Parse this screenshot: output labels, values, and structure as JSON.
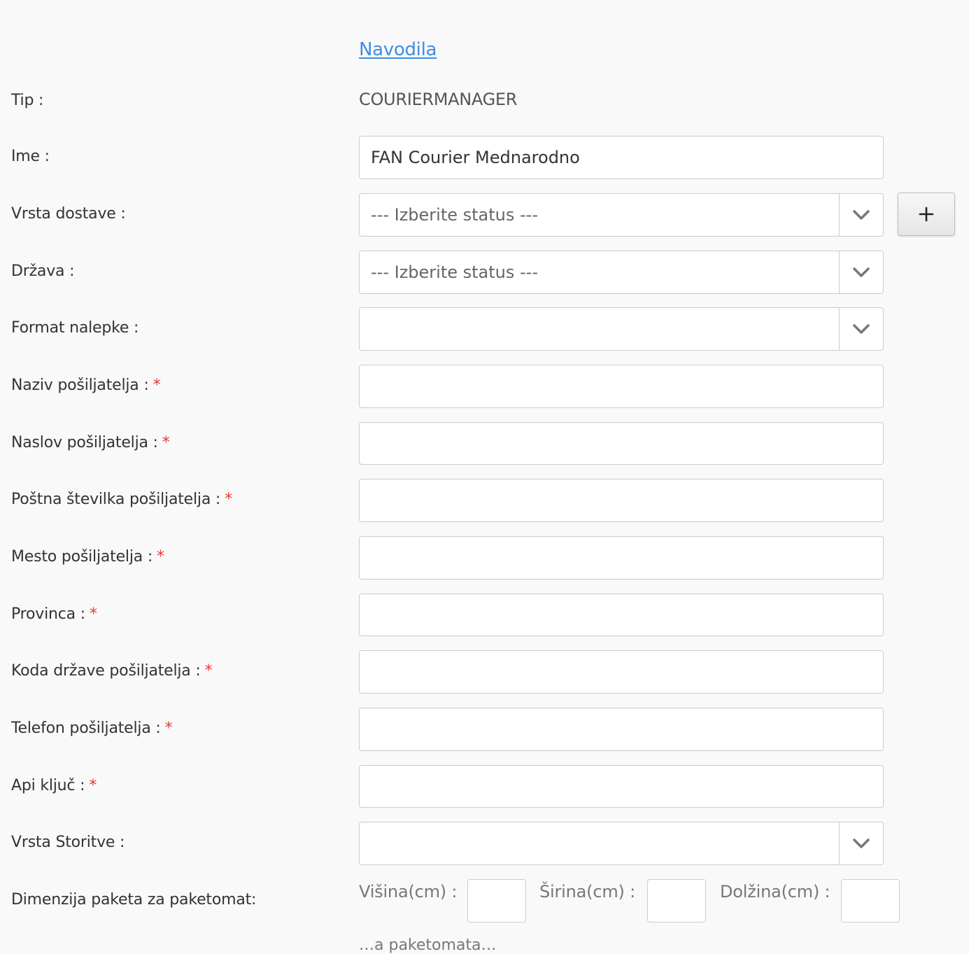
{
  "header": {
    "instructions_link": "Navodila"
  },
  "fields": {
    "tip": {
      "label": "Tip :",
      "value": "COURIERMANAGER"
    },
    "ime": {
      "label": "Ime :",
      "value": "FAN Courier Mednarodno"
    },
    "vrsta_dostave": {
      "label": "Vrsta dostave :",
      "value": "--- Izberite status ---"
    },
    "drzava": {
      "label": "Država :",
      "value": "--- Izberite status ---"
    },
    "format_nalepke": {
      "label": "Format nalepke :",
      "value": ""
    },
    "naziv_posiljatelja": {
      "label": "Naziv pošiljatelja :",
      "value": ""
    },
    "naslov_posiljatelja": {
      "label": "Naslov pošiljatelja :",
      "value": ""
    },
    "postna_stevilka": {
      "label": "Poštna številka pošiljatelja :",
      "value": ""
    },
    "mesto_posiljatelja": {
      "label": "Mesto pošiljatelja :",
      "value": ""
    },
    "provinca": {
      "label": "Provinca :",
      "value": ""
    },
    "koda_drzave": {
      "label": "Koda države pošiljatelja :",
      "value": ""
    },
    "telefon_posiljatelja": {
      "label": "Telefon pošiljatelja :",
      "value": ""
    },
    "api_kljuc": {
      "label": "Api ključ :",
      "value": ""
    },
    "vrsta_storitve": {
      "label": "Vrsta Storitve :",
      "value": ""
    },
    "dimenzija": {
      "label": "Dimenzija paketa za paketomat:",
      "visina_label": "Višina(cm) :",
      "sirina_label": "Širina(cm) :",
      "dolzina_label": "Dolžina(cm) :",
      "visina_value": "",
      "sirina_value": "",
      "dolzina_value": ""
    }
  },
  "required_marker": "*",
  "add_button_label": "+",
  "truncated_text": "…a paketomata…",
  "colors": {
    "link": "#3f8ee0",
    "required": "#e53935",
    "border": "#cccccc",
    "background": "#f9f9f9"
  },
  "icons": {
    "dropdown": "chevron-down-icon",
    "add": "plus-icon"
  }
}
